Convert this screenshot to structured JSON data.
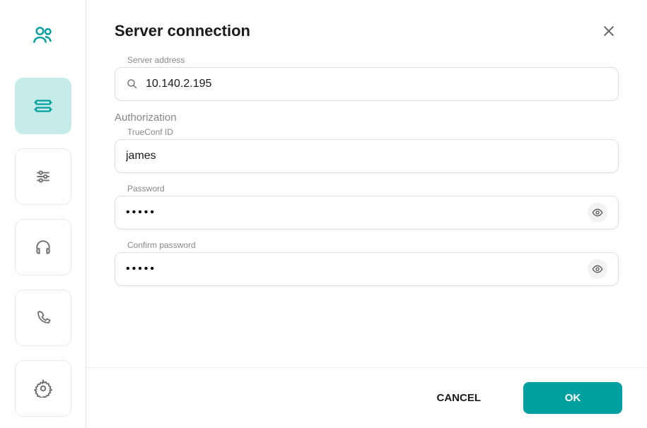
{
  "header": {
    "title": "Server connection"
  },
  "form": {
    "server_address_label": "Server address",
    "server_address_value": "10.140.2.195",
    "authorization_label": "Authorization",
    "trueconf_id_label": "TrueConf ID",
    "trueconf_id_value": "james",
    "password_label": "Password",
    "password_value": "•••••",
    "confirm_password_label": "Confirm password",
    "confirm_password_value": "•••••"
  },
  "footer": {
    "cancel_label": "CANCEL",
    "ok_label": "OK"
  }
}
